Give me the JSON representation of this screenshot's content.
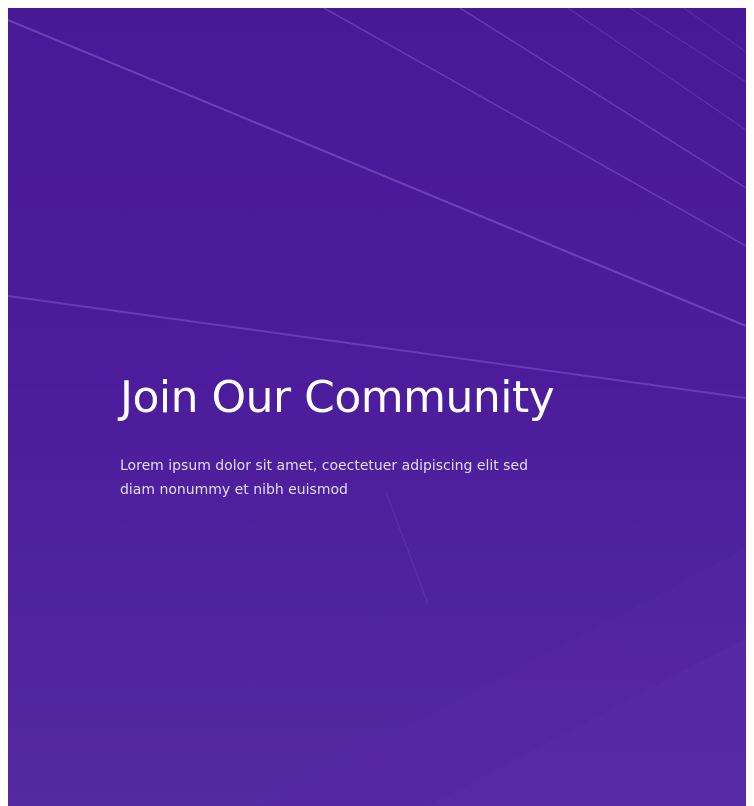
{
  "hero": {
    "title": "Join Our Community",
    "subtitle": "Lorem ipsum dolor sit amet, coectetuer adipiscing elit sed diam nonummy et nibh euismod",
    "background_icon": "abstract-lines-background",
    "colors": {
      "background_top": "#481997",
      "background_bottom": "#55299f",
      "title": "#ffffff",
      "subtitle": "#e6dcf7"
    }
  }
}
